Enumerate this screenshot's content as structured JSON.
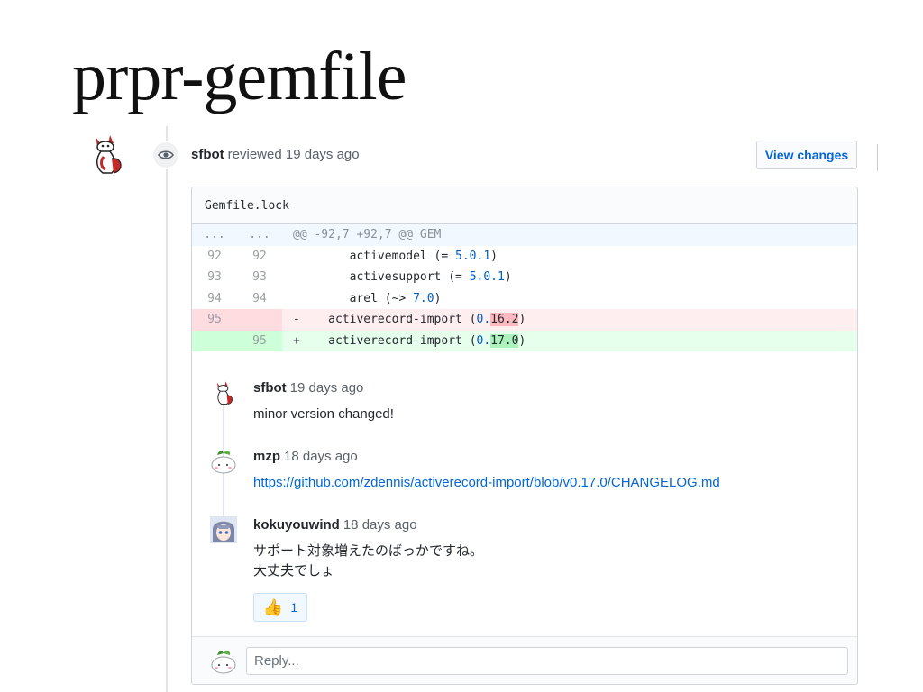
{
  "slide": {
    "title": "prpr-gemfile"
  },
  "review": {
    "user": "sfbot",
    "action": "reviewed 19 days ago",
    "view_changes_label": "View changes"
  },
  "diff": {
    "filename": "Gemfile.lock",
    "hunk": {
      "old": "...",
      "new": "...",
      "text": "@@ -92,7 +92,7 @@ GEM"
    },
    "lines": [
      {
        "old": "92",
        "new": "92",
        "sign": " ",
        "name": "activemodel",
        "op": "(= ",
        "ver": "5.0.1",
        "close": ")"
      },
      {
        "old": "93",
        "new": "93",
        "sign": " ",
        "name": "activesupport",
        "op": "(= ",
        "ver": "5.0.1",
        "close": ")"
      },
      {
        "old": "94",
        "new": "94",
        "sign": " ",
        "name": "arel",
        "op": "(~> ",
        "ver": "7.0",
        "close": ")"
      },
      {
        "old": "95",
        "new": "",
        "sign": "-",
        "name": "activerecord-import",
        "op": "(",
        "ver_pre": "0.",
        "ver_hl": "16.2",
        "close": ")"
      },
      {
        "old": "",
        "new": "95",
        "sign": "+",
        "name": "activerecord-import",
        "op": "(",
        "ver_pre": "0.",
        "ver_hl": "17.0",
        "close": ")"
      }
    ]
  },
  "comments": [
    {
      "user": "sfbot",
      "time": "19 days ago",
      "body": "minor version changed!",
      "avatar": "fox-avatar"
    },
    {
      "user": "mzp",
      "time": "18 days ago",
      "link": "https://github.com/zdennis/activerecord-import/blob/v0.17.0/CHANGELOG.md",
      "avatar": "mochi-avatar"
    },
    {
      "user": "kokuyouwind",
      "time": "18 days ago",
      "body_line1": "サポート対象増えたのばっかですね。",
      "body_line2": "大丈夫でしょ",
      "avatar": "anime-avatar"
    }
  ],
  "reaction": {
    "emoji": "👍",
    "count": "1"
  },
  "reply": {
    "placeholder": "Reply..."
  },
  "colors": {
    "link": "#0366d6",
    "deleted": "#ffeef0",
    "added": "#e6ffed",
    "hunk": "#f1f8ff"
  }
}
